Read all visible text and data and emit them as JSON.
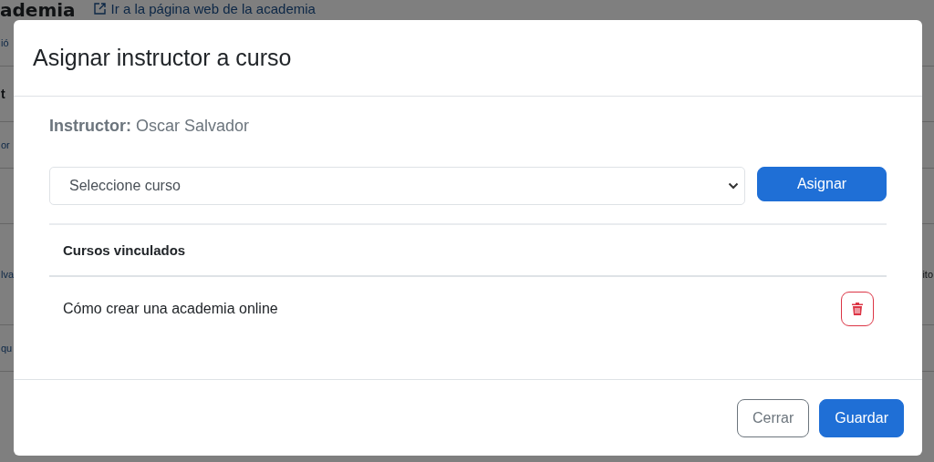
{
  "background_page": {
    "heading": "ademia",
    "website_link": "Ir a la página web de la academia",
    "rows": [
      {
        "left": "ió",
        "right": "",
        "kind": "small"
      },
      {
        "left": "t",
        "right": "",
        "kind": "large"
      },
      {
        "left": "or",
        "right": "",
        "kind": "small"
      },
      {
        "left": "lva",
        "right": "ito",
        "kind": "row"
      },
      {
        "left": "qu",
        "right": "",
        "kind": "small"
      }
    ]
  },
  "modal": {
    "title": "Asignar instructor a curso",
    "instructor_label": "Instructor:",
    "instructor_name": "Oscar Salvador",
    "course_select": {
      "placeholder": "Seleccione curso"
    },
    "assign_button": "Asignar",
    "table": {
      "column_header": "Cursos vinculados",
      "rows": [
        {
          "course": "Cómo crear una academia online"
        }
      ]
    },
    "footer_buttons": [
      {
        "label": "Cerrar",
        "kind": "secondary"
      },
      {
        "label": "Guardar",
        "kind": "primary"
      }
    ]
  }
}
